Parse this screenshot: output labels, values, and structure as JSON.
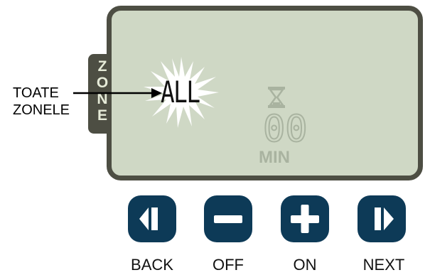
{
  "zone_tab": {
    "letters": [
      "Z",
      "O",
      "N",
      "E"
    ]
  },
  "callout": {
    "line1": "TOATE",
    "line2": "ZONELE"
  },
  "display": {
    "zone_value": "ALL",
    "duration_digits": "00",
    "duration_unit": "MIN"
  },
  "buttons": [
    {
      "label": "BACK",
      "icon": "back-icon"
    },
    {
      "label": "OFF",
      "icon": "minus-icon"
    },
    {
      "label": "ON",
      "icon": "plus-icon"
    },
    {
      "label": "NEXT",
      "icon": "next-icon"
    }
  ],
  "colors": {
    "lcd_background": "#cfd8c5",
    "frame": "#4d4e43",
    "button": "#0d3a57",
    "inactive_segment": "#a9b3a0"
  }
}
